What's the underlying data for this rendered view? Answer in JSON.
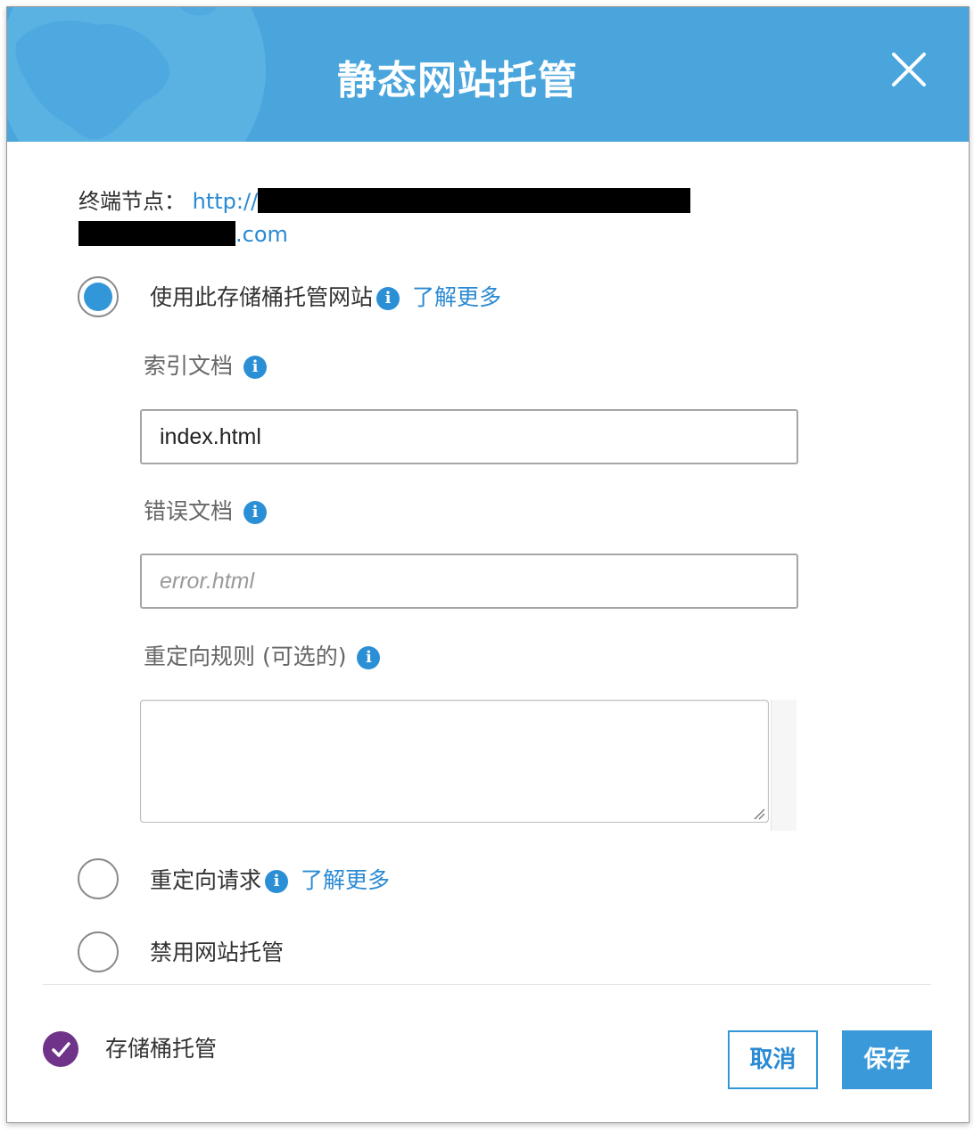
{
  "dialog": {
    "title": "静态网站托管",
    "close_icon": "close-icon"
  },
  "endpoint": {
    "label": "终端节点：",
    "url_prefix": "http://",
    "url_suffix": ".com"
  },
  "options": [
    {
      "label": "使用此存储桶托管网站",
      "learn_more": "了解更多",
      "selected": true
    },
    {
      "label": "重定向请求",
      "learn_more": "了解更多",
      "selected": false
    },
    {
      "label": "禁用网站托管",
      "selected": false
    }
  ],
  "fields": {
    "index_label": "索引文档",
    "index_value": "index.html",
    "error_label": "错误文档",
    "error_placeholder": "error.html",
    "redirect_rules_label": "重定向规则 (可选的)",
    "redirect_rules_value": ""
  },
  "footer": {
    "status_label": "存储桶托管",
    "cancel_label": "取消",
    "save_label": "保存"
  },
  "colors": {
    "header": "#4aa5dd",
    "accent": "#3197d8",
    "status_check": "#6f3389"
  }
}
